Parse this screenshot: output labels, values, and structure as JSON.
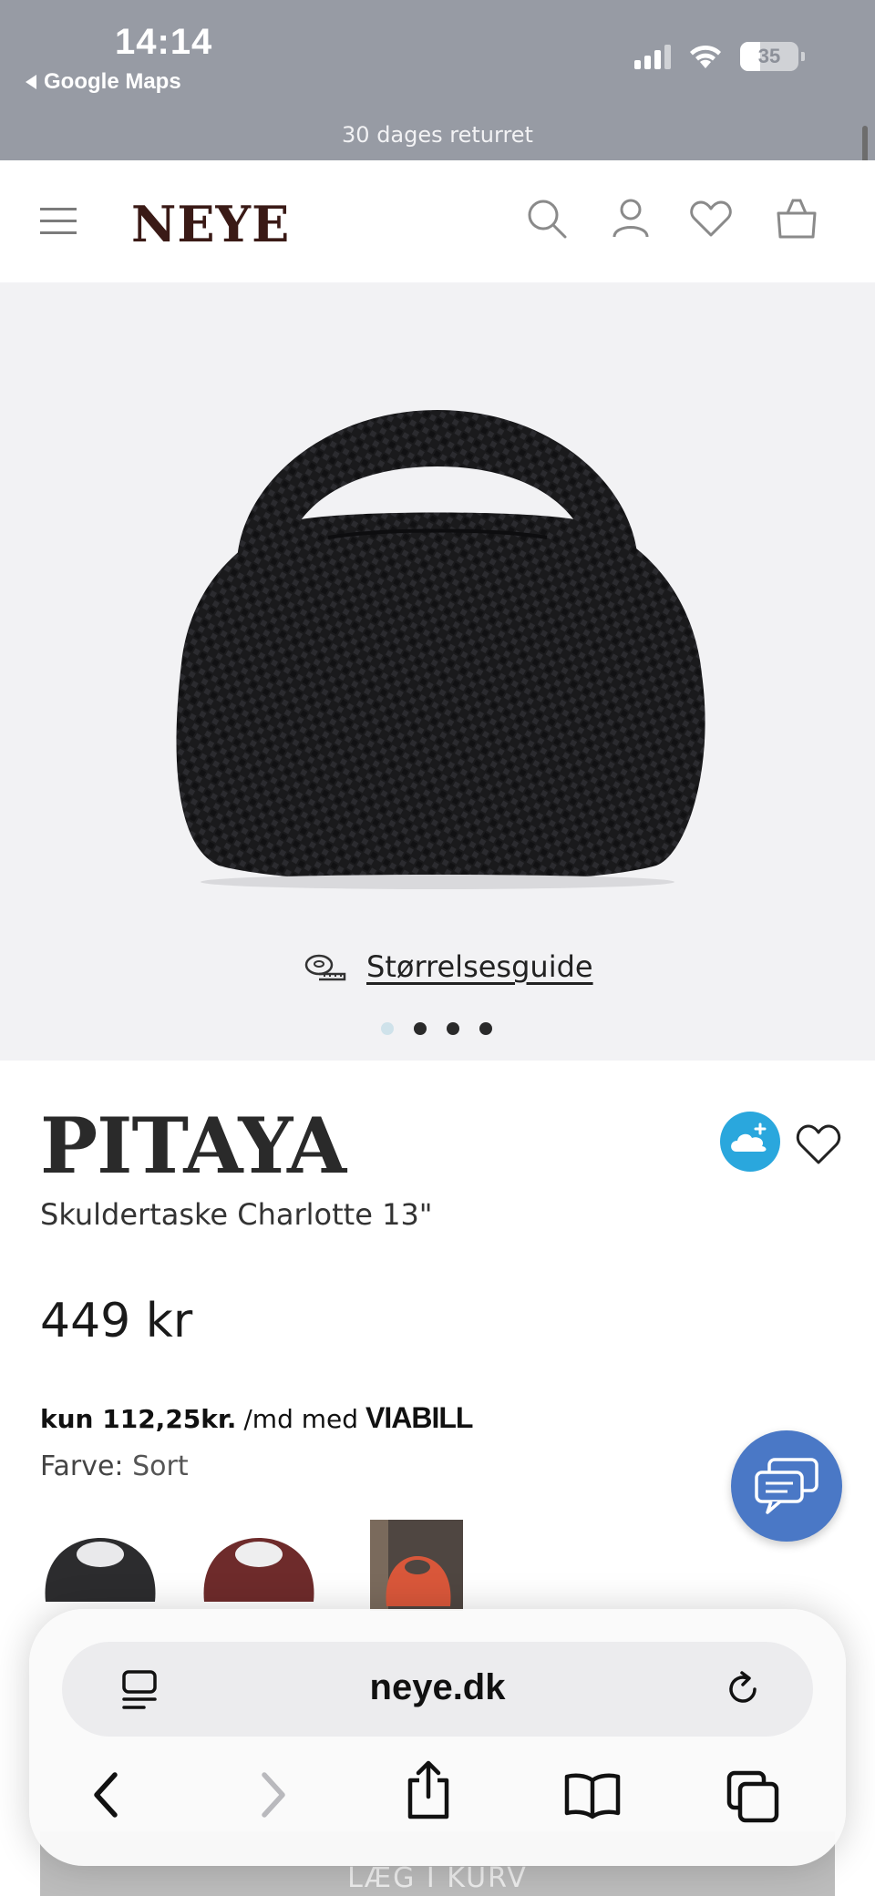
{
  "status_bar": {
    "time": "14:14",
    "back_app": "Google Maps",
    "battery": "35",
    "battery_level": 0.35
  },
  "promo_banner": "30 dages returret",
  "header": {
    "logo": "NEYE"
  },
  "hero": {
    "size_guide_label": "Størrelsesguide",
    "carousel": {
      "count": 4,
      "active": 1
    }
  },
  "product": {
    "brand": "PITAYA",
    "name": "Skuldertaske Charlotte 13\"",
    "price": "449 kr",
    "installment_amount": "kun 112,25kr.",
    "installment_suffix": "/md med",
    "installment_provider": "VIABILL",
    "color_label": "Farve:",
    "color_value": "Sort"
  },
  "safari": {
    "url": "neye.dk"
  },
  "cta": {
    "add_to_cart": "LÆG I KURV"
  },
  "colors": {
    "status_bar_bg": "#979ba4",
    "logo": "#3a1a16",
    "hero_bg": "#f2f2f4",
    "chat_button": "#4a78c6",
    "cloud_button": "#2aa7dd"
  }
}
